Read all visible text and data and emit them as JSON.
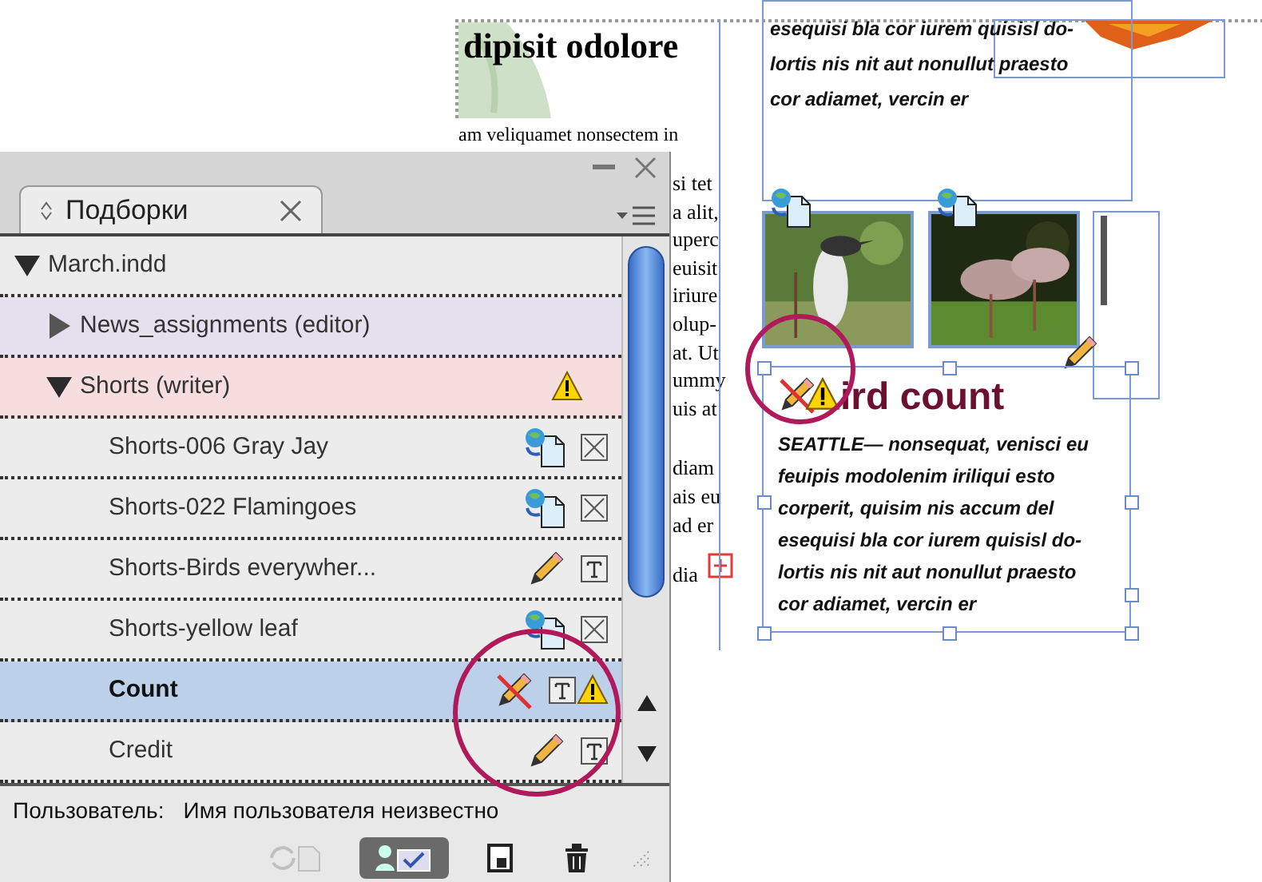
{
  "document": {
    "heading": "dipisit odolore",
    "first_line": "am veliquamet nonsectem in",
    "column_paragraphs": [
      [
        "si tet",
        "a alit,",
        "uperc",
        "euisit",
        "iriure",
        "olup-",
        "at. Ut",
        "ummy",
        "uis at"
      ],
      [
        "diam",
        "ais eu",
        "ad er"
      ],
      [
        "dia"
      ]
    ],
    "top_frame_lines": [
      "esequisi bla cor iurem quisisl do-",
      "lortis nis nit aut nonullut praesto",
      "cor adiamet, vercin er"
    ],
    "headline": "ird count",
    "story_lines": [
      "SEATTLE— nonsequat, venisci eu",
      "feuipis modolenim iriliqui esto",
      "corperit, quisim nis accum del",
      "esequisi bla cor iurem quisisl do-",
      "lortis nis nit aut nonullut praesto",
      "cor adiamet, vercin er"
    ]
  },
  "panel": {
    "tab": {
      "label": "Подборки",
      "selected": true
    },
    "tree": [
      {
        "label": "March.indd",
        "expanded": true,
        "children": [
          {
            "label": "News_assignments (editor)",
            "expanded": false,
            "color": "#e4e0ee",
            "warning": false
          },
          {
            "label": "Shorts (writer)",
            "expanded": true,
            "color": "#f6dede",
            "warning": true,
            "children": [
              {
                "label": "Shorts-006 Gray Jay",
                "kind": "graphic",
                "linked": true,
                "warning": false,
                "selected": false
              },
              {
                "label": "Shorts-022 Flamingoes",
                "kind": "graphic",
                "linked": true,
                "warning": false,
                "selected": false
              },
              {
                "label": "Shorts-Birds everywher...",
                "kind": "text",
                "linked": false,
                "conflict": false,
                "warning": false,
                "selected": false
              },
              {
                "label": "Shorts-yellow leaf",
                "kind": "graphic",
                "linked": true,
                "warning": false,
                "selected": false
              },
              {
                "label": "Count",
                "kind": "text",
                "linked": false,
                "conflict": true,
                "warning": true,
                "selected": true
              },
              {
                "label": "Credit",
                "kind": "text",
                "linked": false,
                "conflict": false,
                "warning": false,
                "selected": false
              }
            ]
          }
        ]
      }
    ],
    "user_label": "Пользователь:",
    "user_name": "Имя пользователя неизвестно",
    "buttons": [
      {
        "kind": "update",
        "disabled": true,
        "pressed": false
      },
      {
        "kind": "edit",
        "disabled": false,
        "pressed": true
      },
      {
        "kind": "new",
        "disabled": false,
        "pressed": false
      },
      {
        "kind": "delete",
        "disabled": false,
        "pressed": false
      }
    ]
  }
}
